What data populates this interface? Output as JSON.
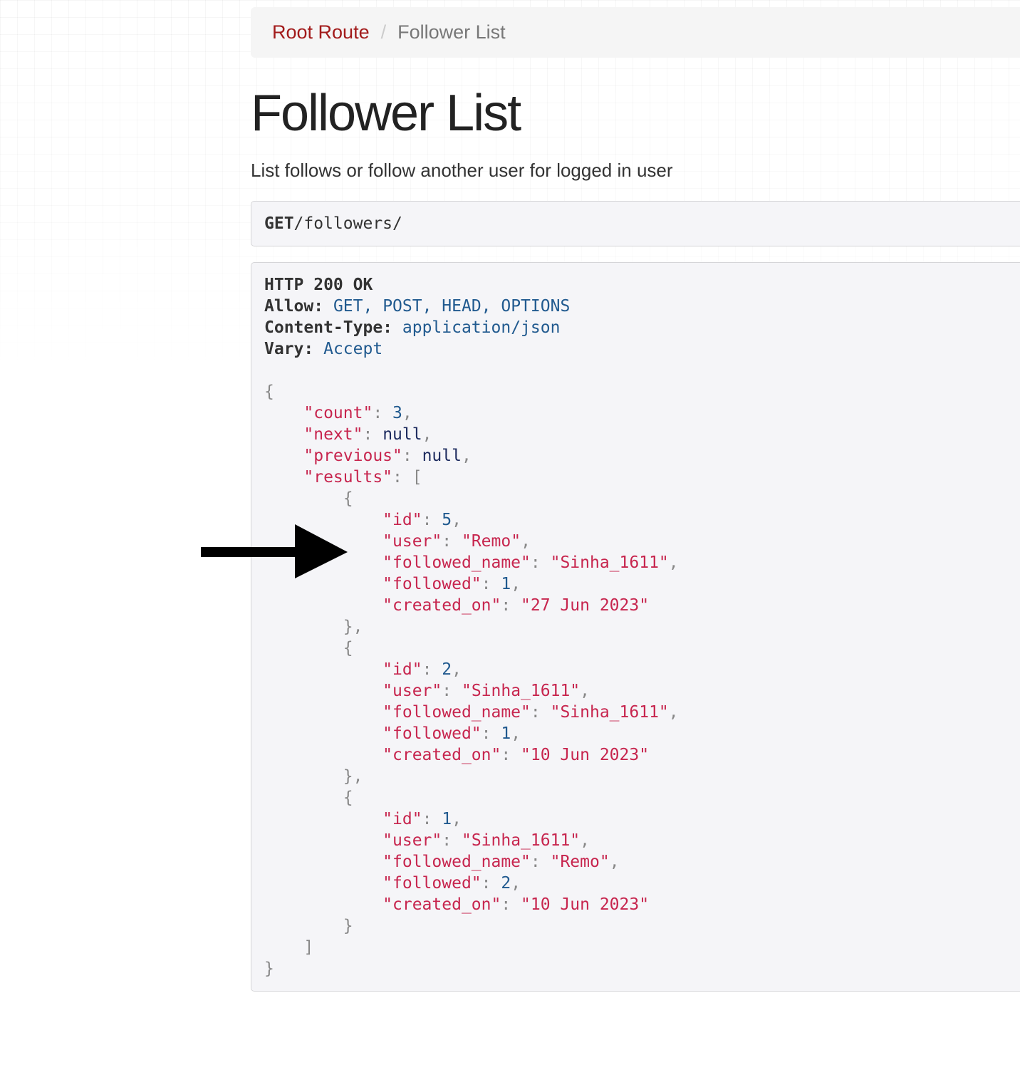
{
  "breadcrumb": {
    "root_label": "Root Route",
    "separator": "/",
    "current_label": "Follower List"
  },
  "page": {
    "title": "Follower List",
    "description": "List follows or follow another user for logged in user"
  },
  "request": {
    "method": "GET",
    "path": "/followers/"
  },
  "response": {
    "status_line": "HTTP 200 OK",
    "headers": [
      {
        "key": "Allow:",
        "value": "GET, POST, HEAD, OPTIONS"
      },
      {
        "key": "Content-Type:",
        "value": "application/json"
      },
      {
        "key": "Vary:",
        "value": "Accept"
      }
    ],
    "body": {
      "count": "3",
      "next": "null",
      "previous": "null",
      "results": [
        {
          "id": "5",
          "user": "\"Remo\"",
          "followed_name": "\"Sinha_1611\"",
          "followed": "1",
          "created_on": "\"27 Jun 2023\""
        },
        {
          "id": "2",
          "user": "\"Sinha_1611\"",
          "followed_name": "\"Sinha_1611\"",
          "followed": "1",
          "created_on": "\"10 Jun 2023\""
        },
        {
          "id": "1",
          "user": "\"Sinha_1611\"",
          "followed_name": "\"Remo\"",
          "followed": "2",
          "created_on": "\"10 Jun 2023\""
        }
      ]
    }
  },
  "json_keys": {
    "count": "\"count\"",
    "next": "\"next\"",
    "previous": "\"previous\"",
    "results": "\"results\"",
    "id": "\"id\"",
    "user": "\"user\"",
    "followed_name": "\"followed_name\"",
    "followed": "\"followed\"",
    "created_on": "\"created_on\""
  },
  "colors": {
    "link": "#a21b1b",
    "string": "#c7254e",
    "number": "#215a8f",
    "literal": "#1c2a5e",
    "punctuation": "#888888",
    "arrow": "#000000"
  },
  "icons": {
    "annotation": "right-arrow-icon"
  }
}
